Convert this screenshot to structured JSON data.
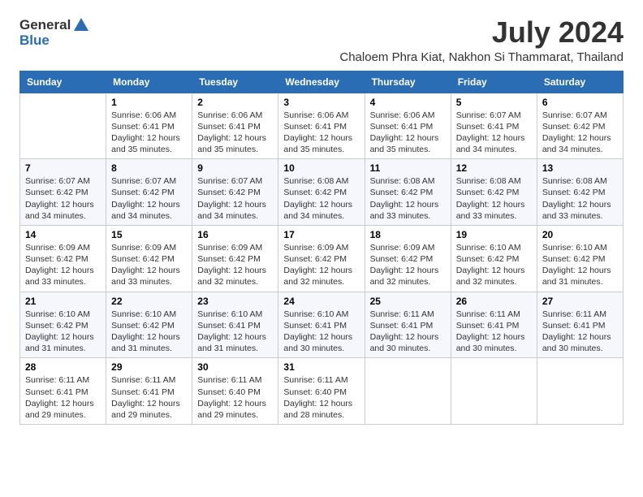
{
  "logo": {
    "general": "General",
    "blue": "Blue",
    "icon": "▶"
  },
  "title": {
    "month_year": "July 2024",
    "subtitle": "Chaloem Phra Kiat, Nakhon Si Thammarat, Thailand"
  },
  "headers": [
    "Sunday",
    "Monday",
    "Tuesday",
    "Wednesday",
    "Thursday",
    "Friday",
    "Saturday"
  ],
  "weeks": [
    [
      {
        "day": "",
        "sunrise": "",
        "sunset": "",
        "daylight": ""
      },
      {
        "day": "1",
        "sunrise": "Sunrise: 6:06 AM",
        "sunset": "Sunset: 6:41 PM",
        "daylight": "Daylight: 12 hours and 35 minutes."
      },
      {
        "day": "2",
        "sunrise": "Sunrise: 6:06 AM",
        "sunset": "Sunset: 6:41 PM",
        "daylight": "Daylight: 12 hours and 35 minutes."
      },
      {
        "day": "3",
        "sunrise": "Sunrise: 6:06 AM",
        "sunset": "Sunset: 6:41 PM",
        "daylight": "Daylight: 12 hours and 35 minutes."
      },
      {
        "day": "4",
        "sunrise": "Sunrise: 6:06 AM",
        "sunset": "Sunset: 6:41 PM",
        "daylight": "Daylight: 12 hours and 35 minutes."
      },
      {
        "day": "5",
        "sunrise": "Sunrise: 6:07 AM",
        "sunset": "Sunset: 6:41 PM",
        "daylight": "Daylight: 12 hours and 34 minutes."
      },
      {
        "day": "6",
        "sunrise": "Sunrise: 6:07 AM",
        "sunset": "Sunset: 6:42 PM",
        "daylight": "Daylight: 12 hours and 34 minutes."
      }
    ],
    [
      {
        "day": "7",
        "sunrise": "Sunrise: 6:07 AM",
        "sunset": "Sunset: 6:42 PM",
        "daylight": "Daylight: 12 hours and 34 minutes."
      },
      {
        "day": "8",
        "sunrise": "Sunrise: 6:07 AM",
        "sunset": "Sunset: 6:42 PM",
        "daylight": "Daylight: 12 hours and 34 minutes."
      },
      {
        "day": "9",
        "sunrise": "Sunrise: 6:07 AM",
        "sunset": "Sunset: 6:42 PM",
        "daylight": "Daylight: 12 hours and 34 minutes."
      },
      {
        "day": "10",
        "sunrise": "Sunrise: 6:08 AM",
        "sunset": "Sunset: 6:42 PM",
        "daylight": "Daylight: 12 hours and 34 minutes."
      },
      {
        "day": "11",
        "sunrise": "Sunrise: 6:08 AM",
        "sunset": "Sunset: 6:42 PM",
        "daylight": "Daylight: 12 hours and 33 minutes."
      },
      {
        "day": "12",
        "sunrise": "Sunrise: 6:08 AM",
        "sunset": "Sunset: 6:42 PM",
        "daylight": "Daylight: 12 hours and 33 minutes."
      },
      {
        "day": "13",
        "sunrise": "Sunrise: 6:08 AM",
        "sunset": "Sunset: 6:42 PM",
        "daylight": "Daylight: 12 hours and 33 minutes."
      }
    ],
    [
      {
        "day": "14",
        "sunrise": "Sunrise: 6:09 AM",
        "sunset": "Sunset: 6:42 PM",
        "daylight": "Daylight: 12 hours and 33 minutes."
      },
      {
        "day": "15",
        "sunrise": "Sunrise: 6:09 AM",
        "sunset": "Sunset: 6:42 PM",
        "daylight": "Daylight: 12 hours and 33 minutes."
      },
      {
        "day": "16",
        "sunrise": "Sunrise: 6:09 AM",
        "sunset": "Sunset: 6:42 PM",
        "daylight": "Daylight: 12 hours and 32 minutes."
      },
      {
        "day": "17",
        "sunrise": "Sunrise: 6:09 AM",
        "sunset": "Sunset: 6:42 PM",
        "daylight": "Daylight: 12 hours and 32 minutes."
      },
      {
        "day": "18",
        "sunrise": "Sunrise: 6:09 AM",
        "sunset": "Sunset: 6:42 PM",
        "daylight": "Daylight: 12 hours and 32 minutes."
      },
      {
        "day": "19",
        "sunrise": "Sunrise: 6:10 AM",
        "sunset": "Sunset: 6:42 PM",
        "daylight": "Daylight: 12 hours and 32 minutes."
      },
      {
        "day": "20",
        "sunrise": "Sunrise: 6:10 AM",
        "sunset": "Sunset: 6:42 PM",
        "daylight": "Daylight: 12 hours and 31 minutes."
      }
    ],
    [
      {
        "day": "21",
        "sunrise": "Sunrise: 6:10 AM",
        "sunset": "Sunset: 6:42 PM",
        "daylight": "Daylight: 12 hours and 31 minutes."
      },
      {
        "day": "22",
        "sunrise": "Sunrise: 6:10 AM",
        "sunset": "Sunset: 6:42 PM",
        "daylight": "Daylight: 12 hours and 31 minutes."
      },
      {
        "day": "23",
        "sunrise": "Sunrise: 6:10 AM",
        "sunset": "Sunset: 6:41 PM",
        "daylight": "Daylight: 12 hours and 31 minutes."
      },
      {
        "day": "24",
        "sunrise": "Sunrise: 6:10 AM",
        "sunset": "Sunset: 6:41 PM",
        "daylight": "Daylight: 12 hours and 30 minutes."
      },
      {
        "day": "25",
        "sunrise": "Sunrise: 6:11 AM",
        "sunset": "Sunset: 6:41 PM",
        "daylight": "Daylight: 12 hours and 30 minutes."
      },
      {
        "day": "26",
        "sunrise": "Sunrise: 6:11 AM",
        "sunset": "Sunset: 6:41 PM",
        "daylight": "Daylight: 12 hours and 30 minutes."
      },
      {
        "day": "27",
        "sunrise": "Sunrise: 6:11 AM",
        "sunset": "Sunset: 6:41 PM",
        "daylight": "Daylight: 12 hours and 30 minutes."
      }
    ],
    [
      {
        "day": "28",
        "sunrise": "Sunrise: 6:11 AM",
        "sunset": "Sunset: 6:41 PM",
        "daylight": "Daylight: 12 hours and 29 minutes."
      },
      {
        "day": "29",
        "sunrise": "Sunrise: 6:11 AM",
        "sunset": "Sunset: 6:41 PM",
        "daylight": "Daylight: 12 hours and 29 minutes."
      },
      {
        "day": "30",
        "sunrise": "Sunrise: 6:11 AM",
        "sunset": "Sunset: 6:40 PM",
        "daylight": "Daylight: 12 hours and 29 minutes."
      },
      {
        "day": "31",
        "sunrise": "Sunrise: 6:11 AM",
        "sunset": "Sunset: 6:40 PM",
        "daylight": "Daylight: 12 hours and 28 minutes."
      },
      {
        "day": "",
        "sunrise": "",
        "sunset": "",
        "daylight": ""
      },
      {
        "day": "",
        "sunrise": "",
        "sunset": "",
        "daylight": ""
      },
      {
        "day": "",
        "sunrise": "",
        "sunset": "",
        "daylight": ""
      }
    ]
  ]
}
